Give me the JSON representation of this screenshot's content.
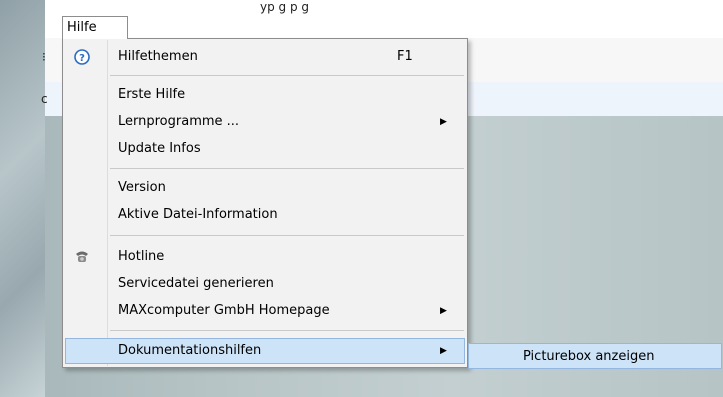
{
  "window": {
    "top_text": "yp                        g         p    g"
  },
  "menubar": {
    "help_label": "Hilfe"
  },
  "menu": {
    "items": [
      {
        "label": "Hilfethemen",
        "shortcut": "F1",
        "icon": "help-circle-icon",
        "arrow": ""
      },
      {
        "label": "Erste Hilfe",
        "shortcut": "",
        "icon": "",
        "arrow": ""
      },
      {
        "label": "Lernprogramme ...",
        "shortcut": "",
        "icon": "",
        "arrow": "▶"
      },
      {
        "label": "Update Infos",
        "shortcut": "",
        "icon": "",
        "arrow": ""
      },
      {
        "label": "Version",
        "shortcut": "",
        "icon": "",
        "arrow": ""
      },
      {
        "label": "Aktive Datei-Information",
        "shortcut": "",
        "icon": "",
        "arrow": ""
      },
      {
        "label": "Hotline",
        "shortcut": "",
        "icon": "telephone-icon",
        "arrow": ""
      },
      {
        "label": "Servicedatei generieren",
        "shortcut": "",
        "icon": "",
        "arrow": ""
      },
      {
        "label": "MAXcomputer GmbH Homepage",
        "shortcut": "",
        "icon": "",
        "arrow": "▶"
      },
      {
        "label": "Dokumentationshilfen",
        "shortcut": "",
        "icon": "",
        "arrow": "▶"
      }
    ]
  },
  "submenu": {
    "items": [
      {
        "label": "Picturebox anzeigen"
      }
    ]
  },
  "left_glyphs": {
    "a": "⁝",
    "b": "c"
  },
  "colors": {
    "highlight_bg": "#cde3f8",
    "highlight_border": "#93b7de",
    "menu_bg": "#f2f2f2"
  }
}
